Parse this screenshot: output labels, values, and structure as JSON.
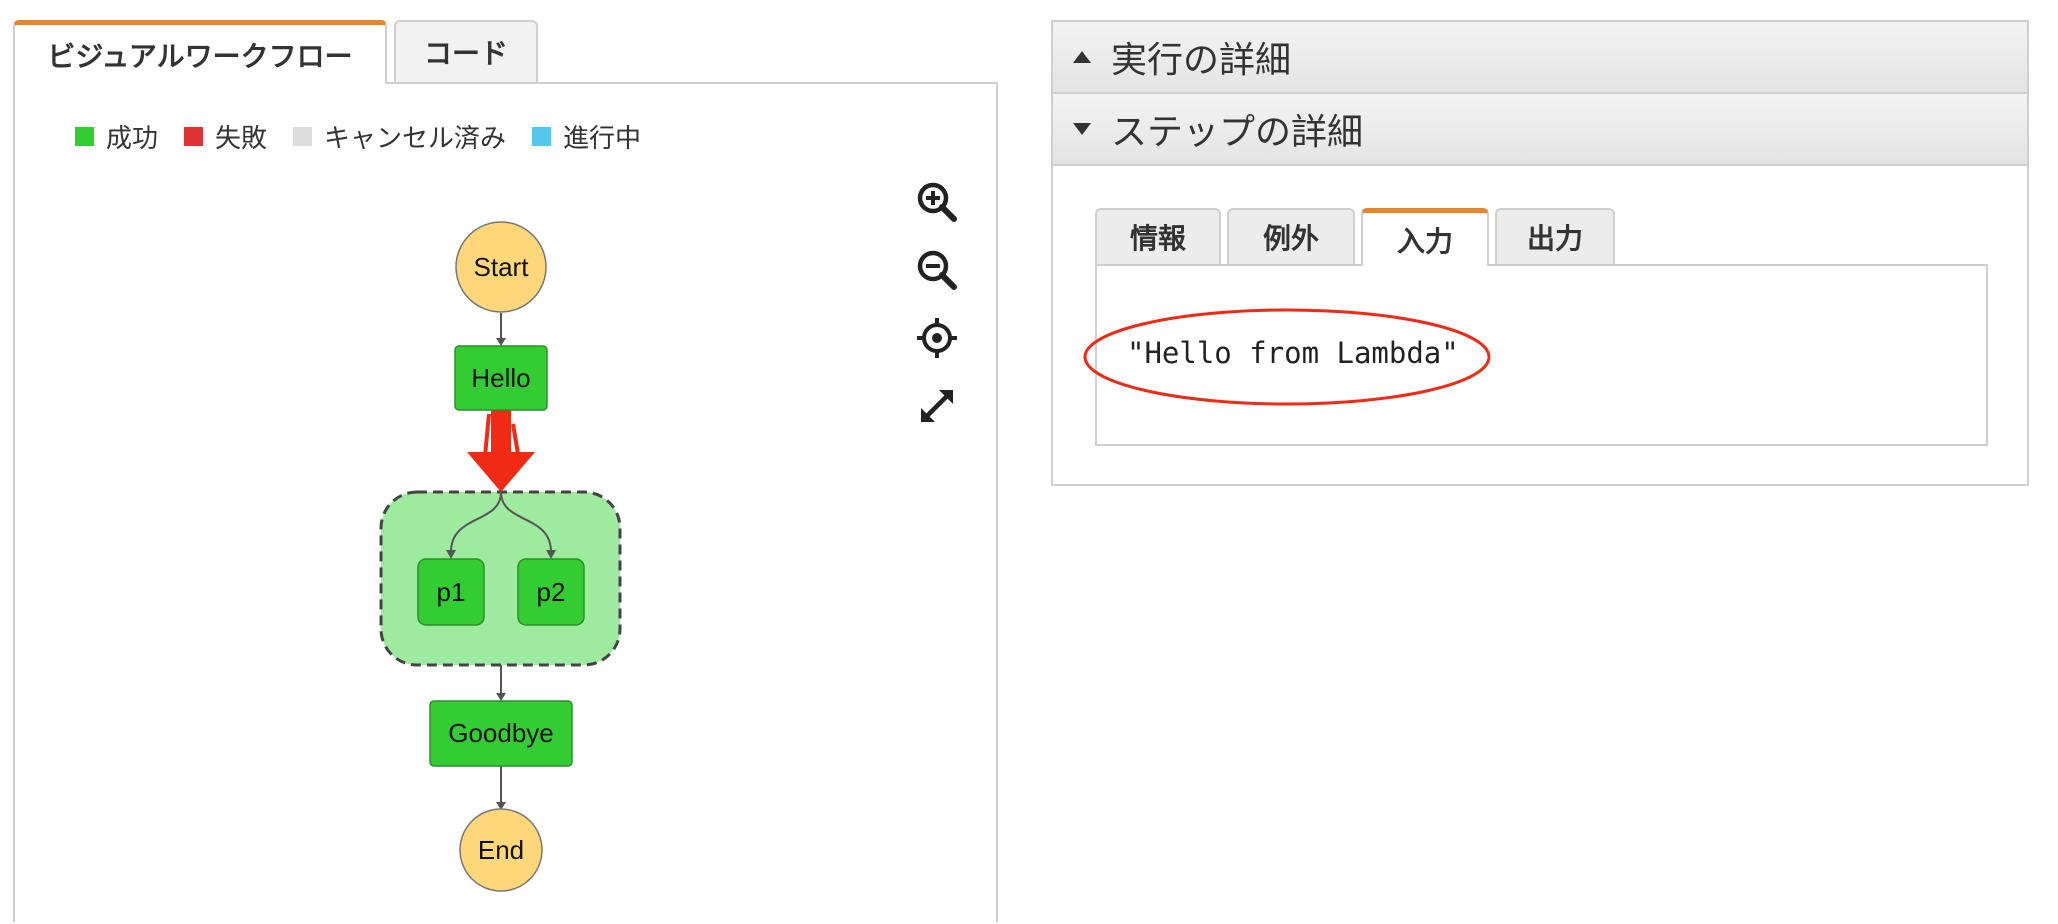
{
  "left_panel": {
    "tabs": [
      {
        "label": "ビジュアルワークフロー",
        "active": true
      },
      {
        "label": "コード",
        "active": false
      }
    ],
    "legend": [
      {
        "label": "成功",
        "color": "#33cc33"
      },
      {
        "label": "失敗",
        "color": "#dd3333"
      },
      {
        "label": "キャンセル済み",
        "color": "#dddddd"
      },
      {
        "label": "進行中",
        "color": "#55c6ec"
      }
    ],
    "zoom_tools": [
      "zoom-in-icon",
      "zoom-out-icon",
      "center-target-icon",
      "expand-icon"
    ],
    "workflow": {
      "start": "Start",
      "hello": "Hello",
      "p1": "p1",
      "p2": "p2",
      "goodbye": "Goodbye",
      "end": "End"
    },
    "colors": {
      "success_fill": "#33cc33",
      "terminal_fill": "#fdd77a",
      "parallel_fill": "#9eea9e",
      "annotation_red": "#f02a14",
      "tab_accent": "#e3862e"
    }
  },
  "right_panel": {
    "sections": [
      {
        "label": "実行の詳細",
        "expanded": false
      },
      {
        "label": "ステップの詳細",
        "expanded": true
      }
    ],
    "step_tabs": [
      {
        "label": "情報",
        "active": false
      },
      {
        "label": "例外",
        "active": false
      },
      {
        "label": "入力",
        "active": true
      },
      {
        "label": "出力",
        "active": false
      }
    ],
    "step_content": "\"Hello from Lambda\""
  }
}
